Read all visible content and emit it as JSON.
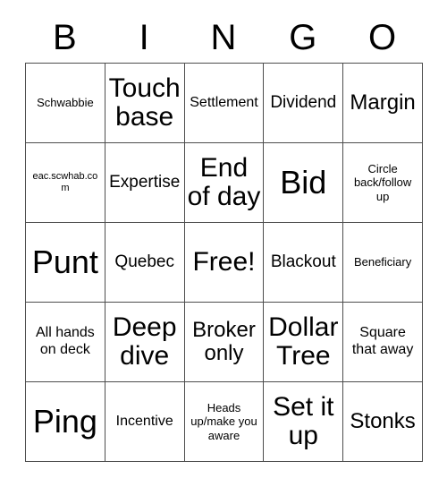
{
  "card": {
    "header_letters": [
      "B",
      "I",
      "N",
      "G",
      "O"
    ],
    "columns": 5,
    "rows": 5,
    "free_space_index": 12,
    "colors": {
      "text": "#000000",
      "grid_line": "#4d4d4d",
      "cell_background": "#ffffff",
      "page_background": "#ffffff"
    },
    "cells": [
      {
        "text": "Schwabbie",
        "size": "s"
      },
      {
        "text": "Touch base",
        "size": "xxl"
      },
      {
        "text": "Settlement",
        "size": "m"
      },
      {
        "text": "Dividend",
        "size": "l"
      },
      {
        "text": "Margin",
        "size": "xl"
      },
      {
        "text": "eac.scwhab.com",
        "size": "xs"
      },
      {
        "text": "Expertise",
        "size": "l"
      },
      {
        "text": "End of day",
        "size": "xxl"
      },
      {
        "text": "Bid",
        "size": "3xl"
      },
      {
        "text": "Circle back/follow up",
        "size": "s"
      },
      {
        "text": "Punt",
        "size": "3xl"
      },
      {
        "text": "Quebec",
        "size": "l"
      },
      {
        "text": "Free!",
        "size": "xxl"
      },
      {
        "text": "Blackout",
        "size": "l"
      },
      {
        "text": "Beneficiary",
        "size": "s"
      },
      {
        "text": "All hands on deck",
        "size": "m"
      },
      {
        "text": "Deep dive",
        "size": "xxl"
      },
      {
        "text": "Broker only",
        "size": "xl"
      },
      {
        "text": "Dollar Tree",
        "size": "xxl"
      },
      {
        "text": "Square that away",
        "size": "m"
      },
      {
        "text": "Ping",
        "size": "3xl"
      },
      {
        "text": "Incentive",
        "size": "m"
      },
      {
        "text": "Heads up/make you aware",
        "size": "s"
      },
      {
        "text": "Set it up",
        "size": "xxl"
      },
      {
        "text": "Stonks",
        "size": "xl"
      }
    ]
  }
}
